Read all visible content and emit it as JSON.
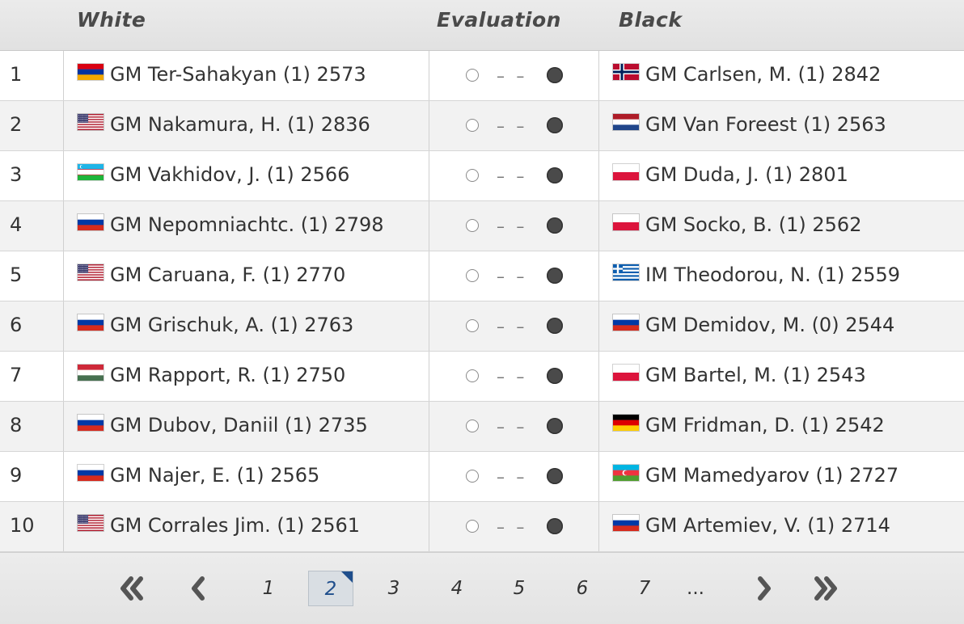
{
  "header": {
    "white": "White",
    "evaluation": "Evaluation",
    "black": "Black"
  },
  "eval_dashes": "– –",
  "rows": [
    {
      "num": "1",
      "white": "GM Ter-Sahakyan (1) 2573",
      "white_flag": "armenia",
      "black": "GM Carlsen, M. (1) 2842",
      "black_flag": "norway"
    },
    {
      "num": "2",
      "white": "GM Nakamura, H. (1) 2836",
      "white_flag": "usa",
      "black": "GM Van Foreest (1) 2563",
      "black_flag": "netherlands"
    },
    {
      "num": "3",
      "white": "GM Vakhidov, J. (1) 2566",
      "white_flag": "uzbekistan",
      "black": "GM Duda, J. (1) 2801",
      "black_flag": "poland"
    },
    {
      "num": "4",
      "white": "GM Nepomniachtc. (1) 2798",
      "white_flag": "russia",
      "black": "GM Socko, B. (1) 2562",
      "black_flag": "poland"
    },
    {
      "num": "5",
      "white": "GM Caruana, F. (1) 2770",
      "white_flag": "usa",
      "black": "IM Theodorou, N. (1) 2559",
      "black_flag": "greece"
    },
    {
      "num": "6",
      "white": "GM Grischuk, A. (1) 2763",
      "white_flag": "russia",
      "black": "GM Demidov, M. (0) 2544",
      "black_flag": "russia"
    },
    {
      "num": "7",
      "white": "GM Rapport, R. (1) 2750",
      "white_flag": "hungary",
      "black": "GM Bartel, M. (1) 2543",
      "black_flag": "poland"
    },
    {
      "num": "8",
      "white": "GM Dubov, Daniil (1) 2735",
      "white_flag": "russia",
      "black": "GM Fridman, D. (1) 2542",
      "black_flag": "germany"
    },
    {
      "num": "9",
      "white": "GM Najer, E. (1) 2565",
      "white_flag": "russia",
      "black": "GM Mamedyarov (1) 2727",
      "black_flag": "azerbaijan"
    },
    {
      "num": "10",
      "white": "GM Corrales Jim. (1) 2561",
      "white_flag": "usa",
      "black": "GM Artemiev, V. (1) 2714",
      "black_flag": "russia"
    }
  ],
  "pagination": {
    "first_icon": "double-chevron-left-icon",
    "prev_icon": "chevron-left-icon",
    "pages": [
      "1",
      "2",
      "3",
      "4",
      "5",
      "6",
      "7"
    ],
    "active_page": "2",
    "ellipsis": "...",
    "next_icon": "chevron-right-icon",
    "last_icon": "double-chevron-right-icon"
  }
}
